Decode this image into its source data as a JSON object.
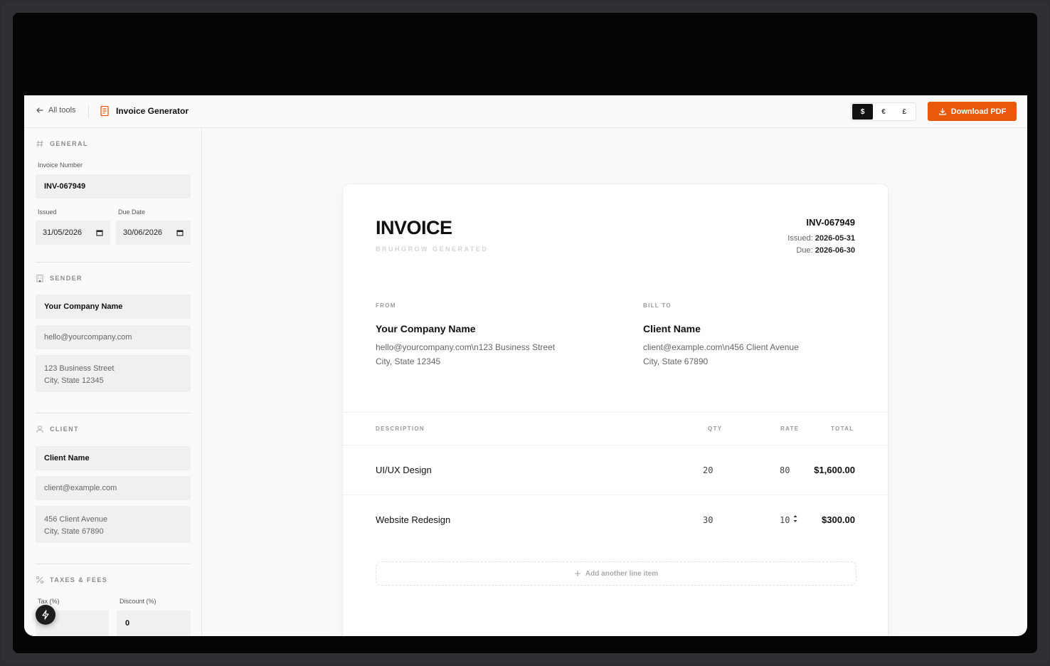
{
  "topbar": {
    "back_label": "All tools",
    "tool_title": "Invoice Generator",
    "currencies": [
      "$",
      "€",
      "£"
    ],
    "active_currency": "$",
    "download_label": "Download PDF",
    "accent": "#e8590c"
  },
  "sidebar": {
    "general": {
      "heading": "GENERAL",
      "invoice_number_label": "Invoice Number",
      "invoice_number": "INV-067949",
      "issued_label": "Issued",
      "issued_value": "31/05/2026",
      "due_label": "Due Date",
      "due_value": "30/06/2026"
    },
    "sender": {
      "heading": "SENDER",
      "name": "Your Company Name",
      "email": "hello@yourcompany.com",
      "address_line1": "123 Business Street",
      "address_line2": "City, State 12345"
    },
    "client": {
      "heading": "CLIENT",
      "name": "Client Name",
      "email": "client@example.com",
      "address_line1": "456 Client Avenue",
      "address_line2": "City, State 67890"
    },
    "taxes": {
      "heading": "TAXES & FEES",
      "tax_label": "Tax (%)",
      "tax_value": "",
      "discount_label": "Discount (%)",
      "discount_value": "0"
    }
  },
  "invoice": {
    "title": "INVOICE",
    "subtitle": "BRUHGROW GENERATED",
    "number": "INV-067949",
    "issued_label": "Issued:",
    "issued_value": "2026-05-31",
    "due_label": "Due:",
    "due_value": "2026-06-30",
    "from_label": "FROM",
    "from_name": "Your Company Name",
    "from_line1": "hello@yourcompany.com\\n123 Business Street",
    "from_line2": "City, State 12345",
    "bill_label": "BILL TO",
    "bill_name": "Client Name",
    "bill_line1": "client@example.com\\n456 Client Avenue",
    "bill_line2": "City, State 67890",
    "columns": {
      "description": "DESCRIPTION",
      "qty": "QTY",
      "rate": "RATE",
      "total": "TOTAL"
    },
    "items": [
      {
        "description": "UI/UX Design",
        "qty": "20",
        "rate": "80",
        "total": "$1,600.00"
      },
      {
        "description": "Website Redesign",
        "qty": "30",
        "rate": "10",
        "total": "$300.00"
      }
    ],
    "add_line_label": "Add another line item"
  }
}
